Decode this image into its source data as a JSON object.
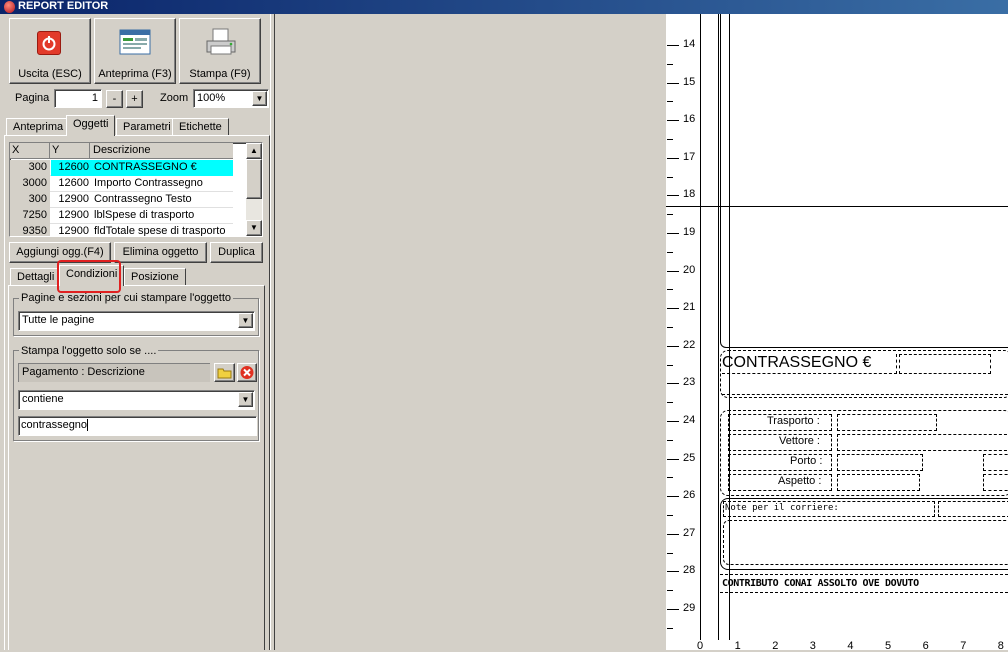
{
  "window": {
    "title": "REPORT EDITOR"
  },
  "toolbar": {
    "exit_label": "Uscita (ESC)",
    "preview_label": "Anteprima (F3)",
    "print_label": "Stampa (F9)",
    "page_label": "Pagina",
    "page_value": "1",
    "page_minus": "-",
    "page_plus": "+",
    "zoom_label": "Zoom",
    "zoom_value": "100%"
  },
  "tabs_top": [
    "Anteprima",
    "Oggetti",
    "Parametri",
    "Etichette"
  ],
  "objects_grid": {
    "headers": [
      "X",
      "Y",
      "Descrizione"
    ],
    "rows": [
      {
        "x": "300",
        "y": "12600",
        "desc": "CONTRASSEGNO €"
      },
      {
        "x": "3000",
        "y": "12600",
        "desc": "Importo Contrassegno"
      },
      {
        "x": "300",
        "y": "12900",
        "desc": "Contrassegno Testo"
      },
      {
        "x": "7250",
        "y": "12900",
        "desc": "lblSpese di trasporto"
      },
      {
        "x": "9350",
        "y": "12900",
        "desc": "fldTotale spese di trasporto"
      }
    ],
    "selected_row": 0,
    "selected_color": "#00ffff"
  },
  "object_buttons": {
    "add": "Aggiungi ogg.(F4)",
    "delete": "Elimina oggetto",
    "duplicate": "Duplica"
  },
  "tabs_bottom": [
    "Dettagli",
    "Condizioni",
    "Posizione"
  ],
  "conditions": {
    "pages_group_label": "Pagine e sezioni per cui stampare l'oggetto",
    "pages_value": "Tutte le pagine",
    "print_if_group_label": "Stampa l'oggetto solo se ....",
    "field_label": "Pagamento : Descrizione",
    "operator_value": "contiene",
    "text_value": "contrassegno",
    "highlight_color": "#e02020"
  },
  "report": {
    "ruler_numbers": [
      "14",
      "15",
      "16",
      "17",
      "18",
      "19",
      "20",
      "21",
      "22",
      "23",
      "24",
      "25",
      "26",
      "27",
      "28",
      "29"
    ],
    "h_ruler_numbers": [
      "0",
      "1",
      "2",
      "3",
      "4",
      "5",
      "6",
      "7",
      "8"
    ],
    "contrassegno_label": "CONTRASSEGNO €",
    "trasporto_label": "Trasporto :",
    "vettore_label": "Vettore :",
    "porto_label": "Porto :",
    "aspetto_label": "Aspetto :",
    "note_label": "Note per il corriere:",
    "conai_label": "CONTRIBUTO CONAI ASSOLTO OVE DOVUTO"
  }
}
